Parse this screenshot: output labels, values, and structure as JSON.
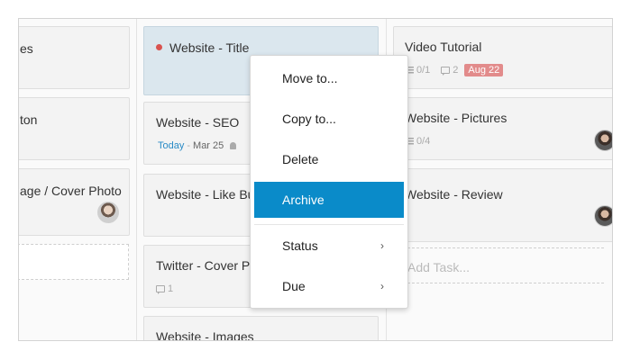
{
  "columns": {
    "left": {
      "cards": [
        {
          "title": "es"
        },
        {
          "title": "ton"
        },
        {
          "title": "age / Cover Photo"
        }
      ]
    },
    "middle": {
      "cards": [
        {
          "title": "Website - Title",
          "status_color": "#d9534f"
        },
        {
          "title": "Website - SEO",
          "due_today": "Today",
          "due_sep": "-",
          "due_date": "Mar 25"
        },
        {
          "title": "Website - Like Bu"
        },
        {
          "title": "Twitter - Cover P",
          "comments": "1"
        },
        {
          "title": "Website - Images"
        }
      ]
    },
    "right": {
      "cards": [
        {
          "title": "Video Tutorial",
          "checklist": "0/1",
          "comments": "2",
          "due_badge": "Aug 22"
        },
        {
          "title": "Website - Pictures",
          "checklist": "0/4"
        },
        {
          "title": "Website - Review"
        }
      ],
      "add_task_placeholder": "Add Task..."
    }
  },
  "context_menu": {
    "items": [
      {
        "label": "Move to..."
      },
      {
        "label": "Copy to..."
      },
      {
        "label": "Delete"
      },
      {
        "label": "Archive",
        "active": true
      },
      {
        "label": "Status",
        "submenu": "›"
      },
      {
        "label": "Due",
        "submenu": "›"
      }
    ]
  },
  "colors": {
    "accent": "#0a8bc9",
    "overdue": "#e28b8b",
    "today": "#2a8bc6",
    "selected_card": "#dbe7ee"
  }
}
